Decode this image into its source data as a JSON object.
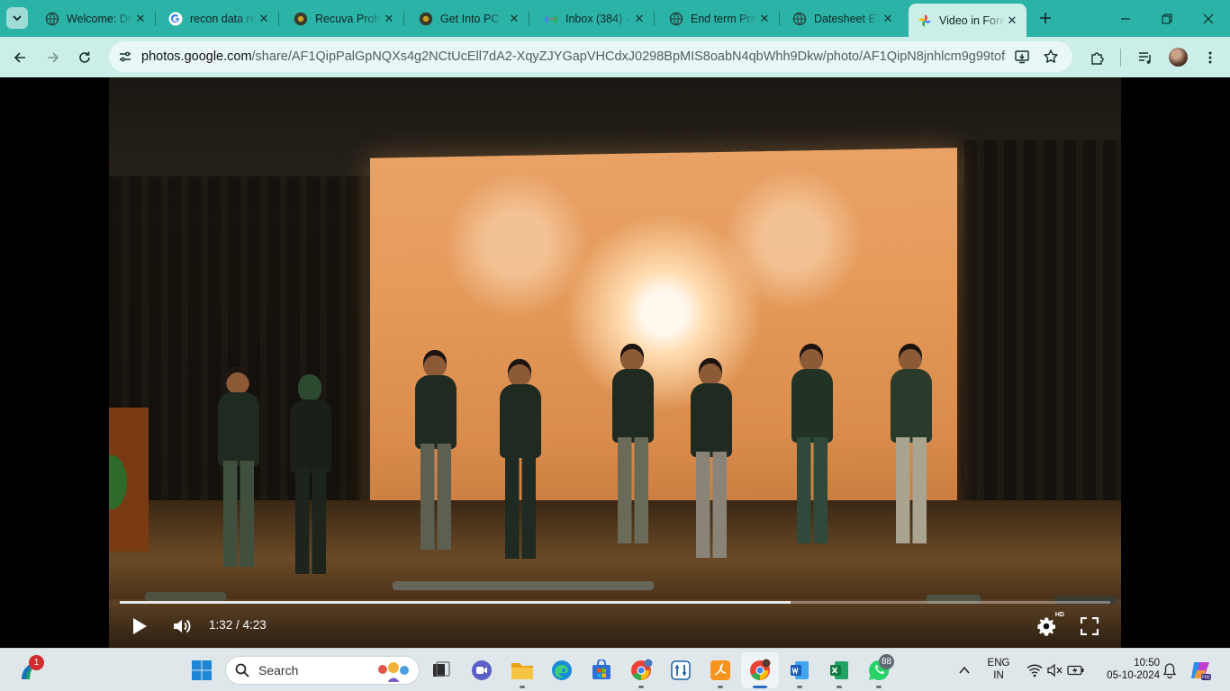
{
  "browser": {
    "tabs": [
      {
        "title": "Welcome: Dr.",
        "icon": "globe"
      },
      {
        "title": "recon data re",
        "icon": "google"
      },
      {
        "title": "Recuva Profe",
        "icon": "chrome-dark"
      },
      {
        "title": "Get Into PC",
        "icon": "chrome-dark"
      },
      {
        "title": "Inbox (384) -",
        "icon": "gmail"
      },
      {
        "title": "End term Pra",
        "icon": "globe"
      },
      {
        "title": "Datesheet ET",
        "icon": "globe"
      },
      {
        "title": "Video in Fore",
        "icon": "google-photos",
        "active": true
      }
    ],
    "url_host": "photos.google.com",
    "url_path": "/share/AF1QipPalGpNQXs4g2NCtUcEll7dA2-XqyZJYGapVHCdxJ0298BpMIS8oabN4qbWhh9Dkw/photo/AF1QipN8jnhlcm9g99tofJ8_7-..."
  },
  "player": {
    "current_time": "1:32",
    "duration": "4:23",
    "time_display": "1:32 / 4:23",
    "progress_fraction": 0.677,
    "quality_badge": "HD"
  },
  "taskbar": {
    "search_placeholder": "Search",
    "widgets_badge": "1",
    "whatsapp_badge": "88",
    "language_line1": "ENG",
    "language_line2": "IN",
    "time": "10:50",
    "date": "05-10-2024"
  },
  "colors": {
    "tabstrip": "#2bb3a7",
    "toolbar": "#cbeee9",
    "taskbar": "#dfe7ea",
    "accent": "#2b6cc4"
  }
}
